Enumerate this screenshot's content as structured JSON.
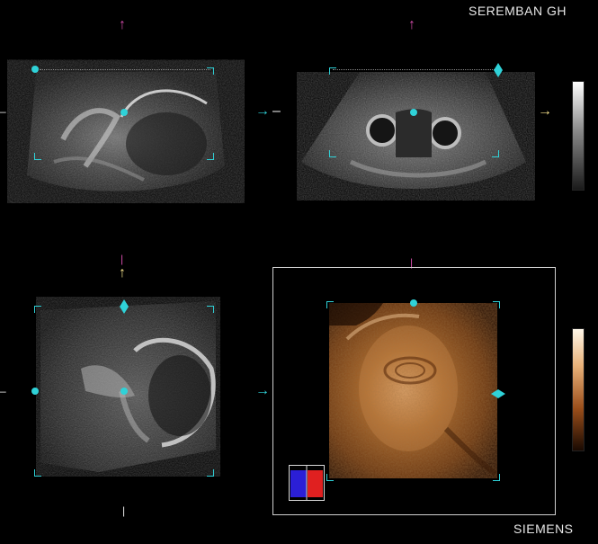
{
  "header": {
    "site_label": "SEREMBAN GH"
  },
  "footer": {
    "vendor_label": "SIEMENS"
  },
  "colors": {
    "marker": "#2fd2d8",
    "orientation_top": "#d04ba8",
    "orientation_side": "#f3e08a",
    "render_tone": "#b06a2a"
  },
  "icons": {
    "top_arrow": "arrow-up",
    "side_arrow": "arrow-right"
  },
  "symbols": {
    "up": "↑",
    "right": "→",
    "dash": "–",
    "bar": "|"
  }
}
